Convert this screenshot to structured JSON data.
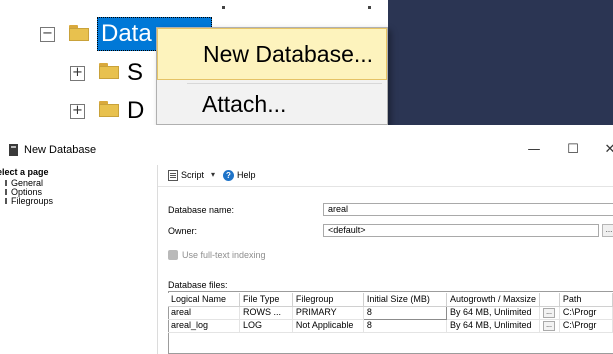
{
  "object_explorer": {
    "databases_label": "Data",
    "child_node_1_label": "S",
    "child_node_2_label": "D",
    "expand_glyph": "+",
    "collapse_glyph": "−"
  },
  "context_menu": {
    "items": [
      {
        "label": "New Database..."
      },
      {
        "label": "Attach..."
      }
    ]
  },
  "dialog": {
    "title": "New Database",
    "window_buttons": {
      "minimize": "—",
      "maximize": "☐",
      "close": "✕"
    },
    "left_panel": {
      "header": "elect a page",
      "pages": [
        "General",
        "Options",
        "Filegroups"
      ]
    },
    "toolbar": {
      "script_label": "Script",
      "script_caret": "▾",
      "help_label": "Help",
      "help_glyph": "?"
    },
    "form": {
      "database_name_label": "Database name:",
      "database_name_value": "areal",
      "owner_label": "Owner:",
      "owner_value": "<default>",
      "owner_browse_label": "...",
      "fulltext_label": "Use full-text indexing",
      "fulltext_checked": true,
      "database_files_label": "Database files:"
    },
    "files_table": {
      "columns": [
        "Logical Name",
        "File Type",
        "Filegroup",
        "Initial Size (MB)",
        "Autogrowth / Maxsize",
        "",
        "Path"
      ],
      "rows": [
        [
          "areal",
          "ROWS ...",
          "PRIMARY",
          "8",
          "By 64 MB, Unlimited",
          "...",
          "C:\\Progr"
        ],
        [
          "areal_log",
          "LOG",
          "Not Applicable",
          "8",
          "By 64 MB, Unlimited",
          "...",
          "C:\\Progr"
        ]
      ]
    }
  }
}
